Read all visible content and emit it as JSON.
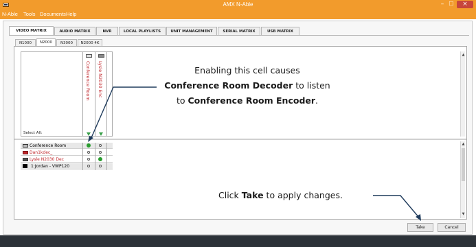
{
  "window": {
    "title": "AMX N-Able",
    "min": "–",
    "max": "☐",
    "close": "×"
  },
  "menu": [
    "N-Able",
    "Tools",
    "Documents",
    "Help"
  ],
  "tabs": [
    "VIDEO MATRIX",
    "AUDIO MATRIX",
    "NVR",
    "LOCAL PLAYLISTS",
    "UNIT MANAGEMENT",
    "SERIAL MATRIX",
    "USB MATRIX"
  ],
  "subtabs": [
    "N1000",
    "N2000",
    "N3000",
    "N2000 4K"
  ],
  "matrix": {
    "columns": [
      "Conference Room",
      "Lysle N2030 Enc"
    ],
    "select_all": "Select All:",
    "rows": [
      {
        "label": "Conference Room",
        "color": "#000000",
        "cells": [
          true,
          false
        ]
      },
      {
        "label": "Dan1kdec_",
        "color": "#c0262b",
        "cells": [
          false,
          false
        ]
      },
      {
        "label": "Lysle N2030 Dec",
        "color": "#c0262b",
        "cells": [
          false,
          true
        ]
      },
      {
        "label": "1:Jordan - VWP120",
        "color": "#000000",
        "cells": [
          false,
          false
        ]
      }
    ]
  },
  "callout1": {
    "line1": "Enabling this cell causes",
    "bold1": "Conference Room Decoder",
    "line2_rest": " to listen",
    "line3_pre": "to ",
    "bold2": "Conference Room Encoder",
    "line3_post": "."
  },
  "callout2": {
    "pre": "Click ",
    "bold": "Take",
    "post": " to apply changes."
  },
  "buttons": {
    "take": "Take",
    "cancel": "Cancel"
  },
  "colors": {
    "titlebar": "#f29b2c",
    "enabled_dot": "#2a9d2f",
    "annotation_arrow": "#1f3b5c"
  }
}
